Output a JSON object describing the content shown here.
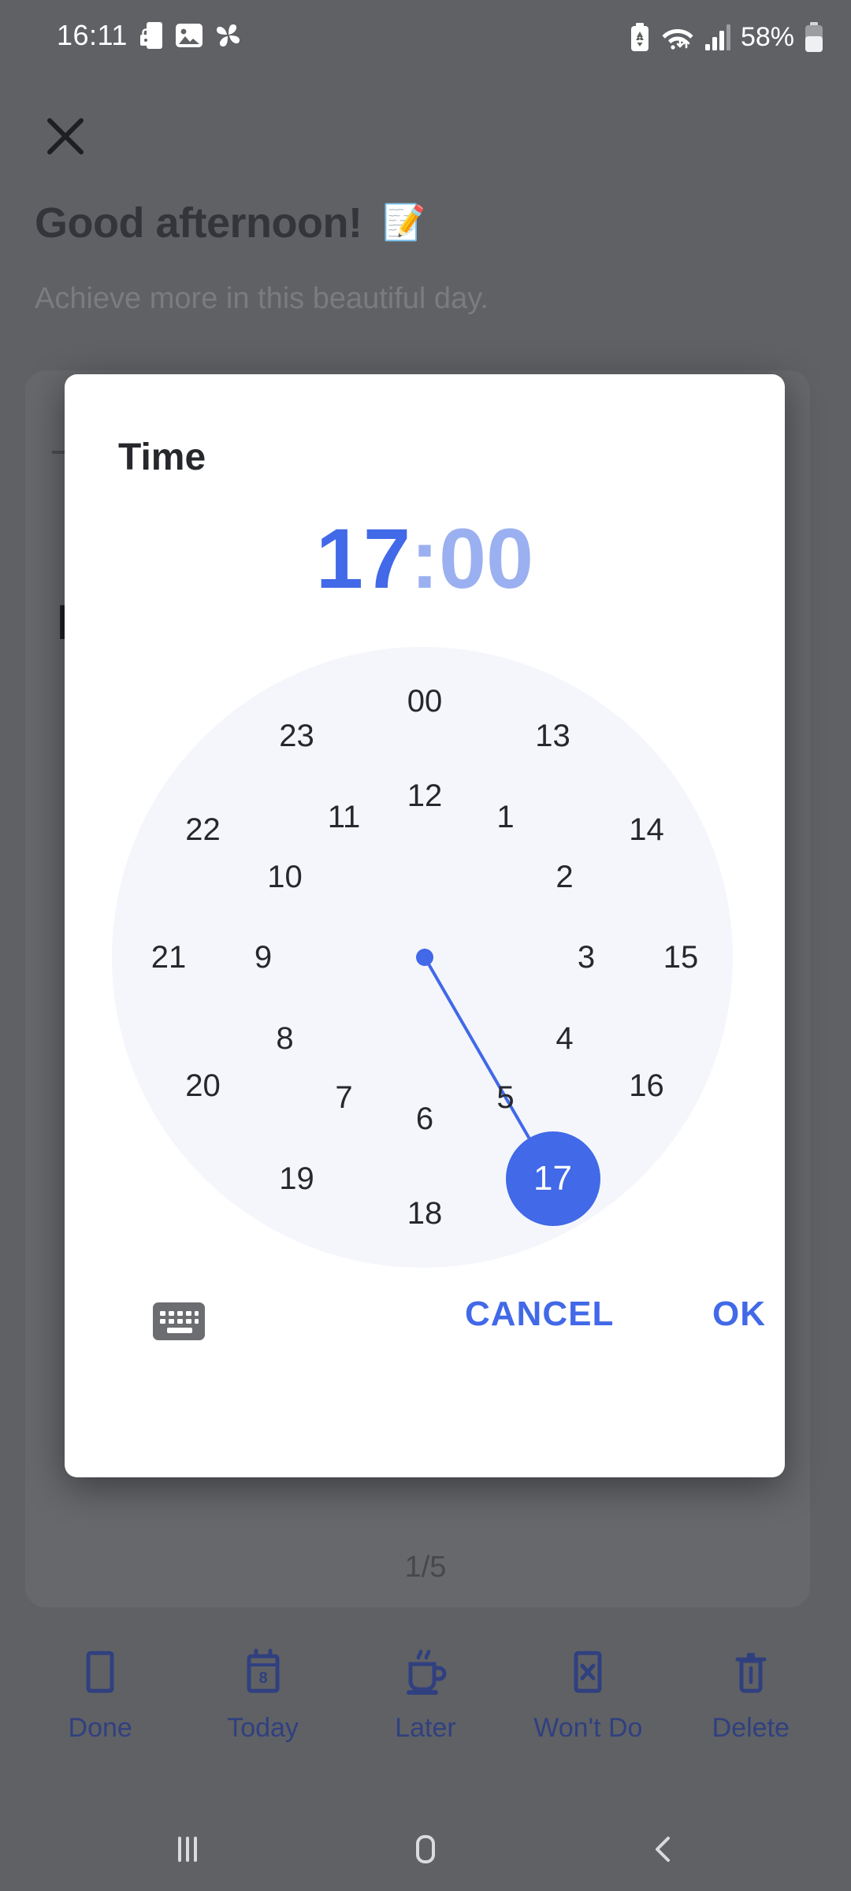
{
  "statusbar": {
    "time": "16:11",
    "battery_percent": "58%",
    "left_icons": [
      "phone-lock-icon",
      "image-icon",
      "pinwheel-icon"
    ],
    "right_icons": [
      "battery-saver-icon",
      "wifi-icon",
      "signal-icon",
      "battery-icon"
    ]
  },
  "header": {
    "close_icon": "close-icon",
    "greeting": "Good afternoon!",
    "greeting_emoji": "📝",
    "subtitle": "Achieve more in this beautiful day."
  },
  "background": {
    "page_counter": "1/5",
    "card_letter": "I"
  },
  "dialog": {
    "title": "Time",
    "hour": "17",
    "colon": ":",
    "minute": "00",
    "selected_hour": 17,
    "keyboard_icon": "keyboard-icon",
    "cancel_label": "CANCEL",
    "ok_label": "OK",
    "accent_color": "#4169E8",
    "accent_muted_color": "#9BB0F0",
    "face_color": "#F5F6FC",
    "outer_ring": [
      "00",
      "13",
      "14",
      "15",
      "16",
      "17",
      "18",
      "19",
      "20",
      "21",
      "22",
      "23"
    ],
    "inner_ring": [
      "12",
      "1",
      "2",
      "3",
      "4",
      "5",
      "6",
      "7",
      "8",
      "9",
      "10",
      "11"
    ]
  },
  "actionbar": {
    "items": [
      {
        "label": "Done",
        "icon": "checkbox-square-icon"
      },
      {
        "label": "Today",
        "icon": "calendar-8-icon"
      },
      {
        "label": "Later",
        "icon": "coffee-cup-icon"
      },
      {
        "label": "Won't Do",
        "icon": "x-box-icon"
      },
      {
        "label": "Delete",
        "icon": "trash-icon"
      }
    ],
    "color": "#30407f"
  },
  "navbar": {
    "recents_icon": "recents-icon",
    "home_icon": "home-icon",
    "back_icon": "back-icon"
  }
}
